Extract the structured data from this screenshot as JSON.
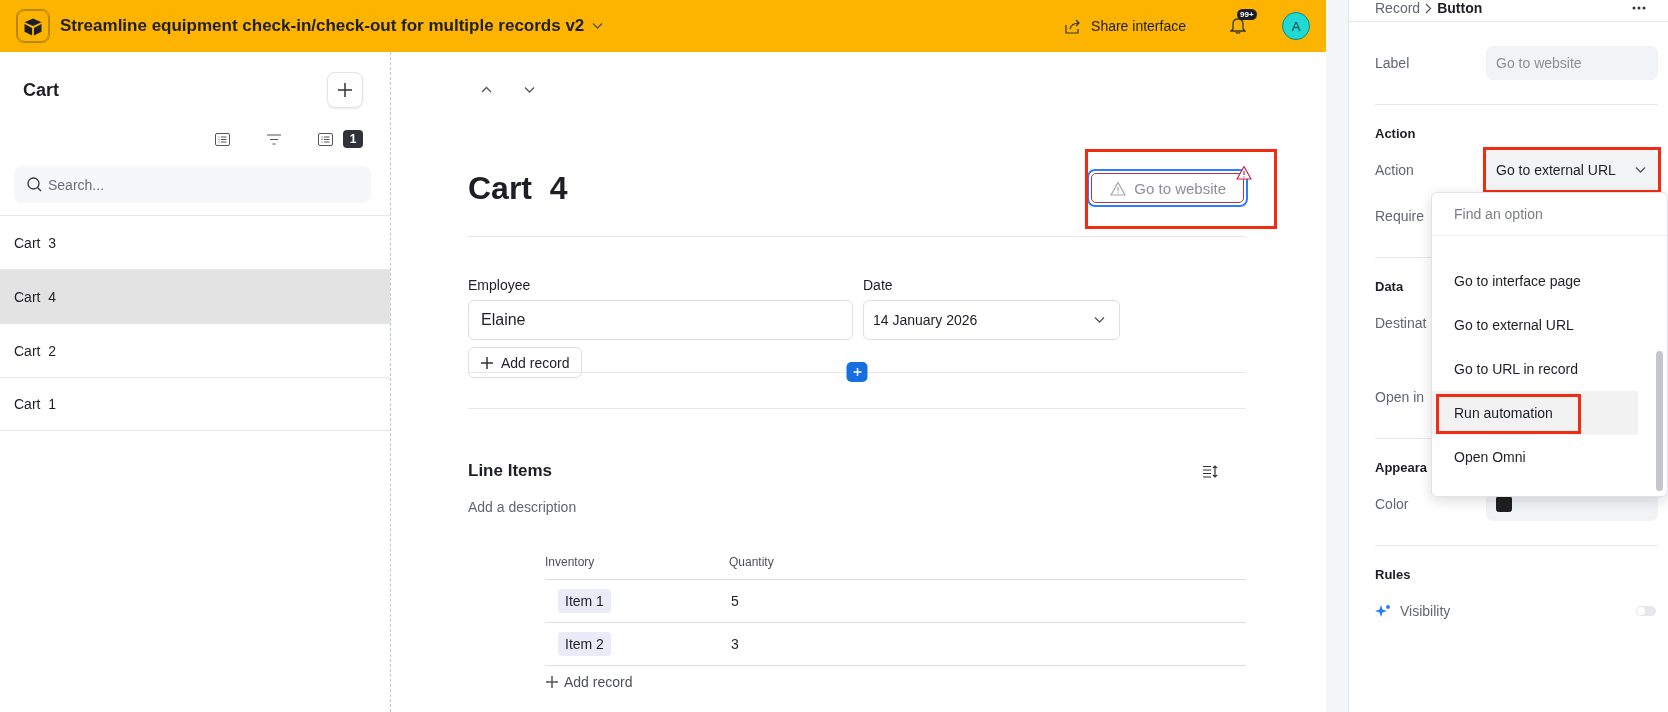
{
  "app_bar": {
    "title": "Streamline equipment check-in/check-out for multiple records v2",
    "share_label": "Share interface",
    "notification_badge": "99+",
    "avatar_initial": "A"
  },
  "sidebar": {
    "title": "Cart",
    "filter_count": "1",
    "search": {
      "placeholder": "Search..."
    },
    "items": [
      {
        "label": "Cart  3",
        "selected": false
      },
      {
        "label": "Cart  4",
        "selected": true
      },
      {
        "label": "Cart  2",
        "selected": false
      },
      {
        "label": "Cart  1",
        "selected": false
      }
    ]
  },
  "record": {
    "title": "Cart  4",
    "button": {
      "label": "Go to website",
      "warning": true
    },
    "fields": [
      {
        "label": "Employee",
        "value": "Elaine",
        "kind": "text"
      },
      {
        "label": "Date",
        "value": "14 January 2026",
        "kind": "date"
      }
    ],
    "add_record": "Add record",
    "section": {
      "title": "Line Items",
      "description": "Add a description",
      "table": {
        "columns": [
          "Inventory",
          "Quantity"
        ],
        "rows": [
          [
            "Item 1",
            "5"
          ],
          [
            "Item 2",
            "3"
          ]
        ]
      },
      "add_record": "Add record"
    }
  },
  "properties": {
    "breadcrumb_parent": "Record",
    "breadcrumb_current": "Button",
    "label_row": {
      "label": "Label",
      "placeholder": "Go to website"
    },
    "action": {
      "title": "Action",
      "label": "Action",
      "value": "Go to external URL",
      "covered_label": "Require"
    },
    "data": {
      "title": "Data",
      "labels": [
        "Destinat",
        "Open in"
      ]
    },
    "appearance": {
      "title": "Appeara",
      "color_label": "Color"
    },
    "rules": {
      "title": "Rules",
      "visibility_label": "Visibility",
      "visibility_on": false
    },
    "dropdown": {
      "placeholder": "Find an option",
      "options": [
        {
          "label": "Go to interface page",
          "highlighted": false
        },
        {
          "label": "Go to external URL",
          "highlighted": false
        },
        {
          "label": "Go to URL in record",
          "highlighted": false
        },
        {
          "label": "Run automation",
          "highlighted": true
        },
        {
          "label": "Open Omni",
          "highlighted": false
        }
      ]
    }
  }
}
